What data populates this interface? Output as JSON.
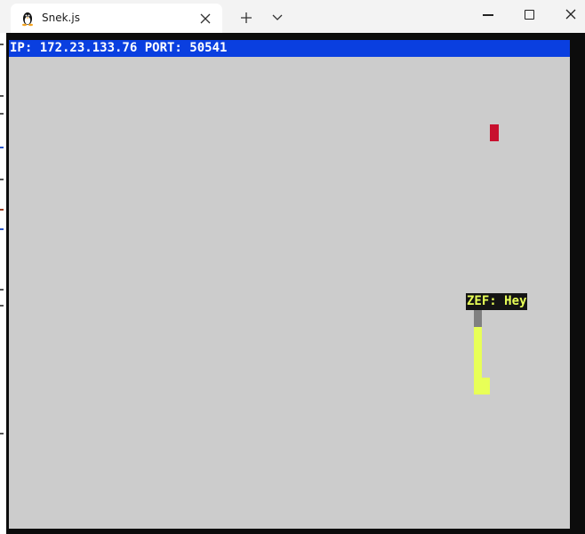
{
  "browser": {
    "tab_title": "Snek.js",
    "tab_icon": "linux-penguin-icon"
  },
  "game": {
    "status_text": "IP: 172.23.133.76 PORT: 50541",
    "chat_bubble": "ZEF: Hey",
    "colors": {
      "background": "#cccccc",
      "status_bar": "#0a3fe0",
      "food": "#c8102e",
      "snake_body": "#e8ff57",
      "snake_head": "#808080",
      "chat_bg": "#141414"
    }
  }
}
